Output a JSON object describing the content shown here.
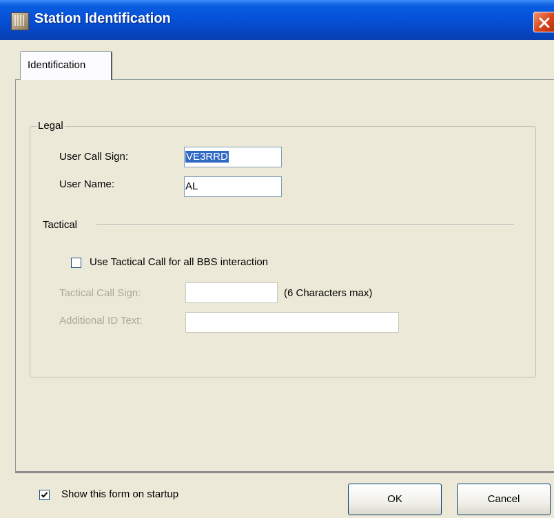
{
  "window": {
    "title": "Station Identification"
  },
  "tabs": [
    {
      "label": "Identification",
      "selected": true
    }
  ],
  "legal": {
    "group_label": "Legal",
    "call_sign_label": "User Call Sign:",
    "call_sign_value": "VE3RRD",
    "user_name_label": "User Name:",
    "user_name_value": "AL"
  },
  "tactical": {
    "group_label": "Tactical",
    "use_tactical_label": "Use Tactical Call for all BBS interaction",
    "use_tactical_checked": false,
    "call_sign_label": "Tactical Call Sign:",
    "call_sign_value": "",
    "call_sign_hint": "(6 Characters max)",
    "additional_id_label": "Additional ID Text:",
    "additional_id_value": ""
  },
  "footer": {
    "show_on_startup_label": "Show this form on startup",
    "show_on_startup_checked": true,
    "ok_label": "OK",
    "cancel_label": "Cancel"
  },
  "colors": {
    "titlebar": "#0651d8",
    "dialog_bg": "#ece9d8",
    "selection": "#316ac5",
    "disabled_text": "#aca899"
  }
}
